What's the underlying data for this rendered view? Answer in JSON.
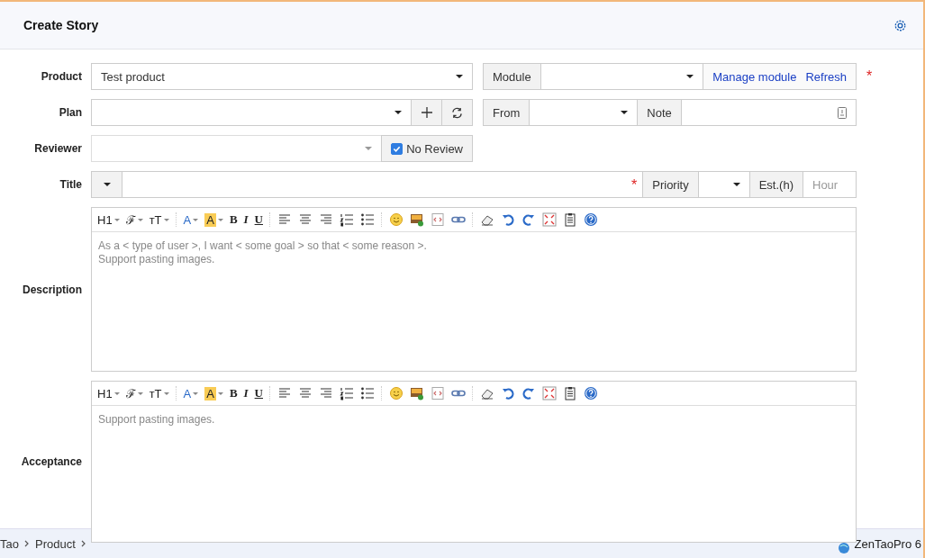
{
  "header": {
    "title": "Create Story"
  },
  "product": {
    "label": "Product",
    "value": "Test product",
    "required_mark": "*",
    "module_label": "Module",
    "links": [
      "Manage module",
      "Refresh"
    ]
  },
  "plan": {
    "label": "Plan",
    "from_label": "From",
    "note_label": "Note"
  },
  "reviewer": {
    "label": "Reviewer",
    "no_review": {
      "label": "No Review",
      "checked": true
    }
  },
  "title": {
    "label": "Title",
    "required_mark": "*",
    "priority_label": "Priority",
    "est_label": "Est.(h)",
    "est_placeholder": "Hour"
  },
  "editors": [
    {
      "label": "Description",
      "lines": [
        "As a < type of user >, I want < some goal > so that < some reason >.",
        "Support pasting images."
      ],
      "toolbar": [
        {
          "kind": "text",
          "label": "H1",
          "dropdown": true
        },
        {
          "kind": "text",
          "label": "ℱ",
          "dropdown": true
        },
        {
          "kind": "text",
          "label": "ᴛT",
          "dropdown": true
        },
        {
          "kind": "separator"
        },
        {
          "kind": "fontcolor",
          "label": "A",
          "dropdown": true
        },
        {
          "kind": "highlight",
          "label": "A",
          "dropdown": true
        },
        {
          "kind": "bold",
          "label": "B",
          "dropdown": false
        },
        {
          "kind": "italic",
          "label": "I",
          "dropdown": false
        },
        {
          "kind": "underline",
          "label": "U",
          "dropdown": false
        },
        {
          "kind": "separator"
        },
        {
          "kind": "align-left"
        },
        {
          "kind": "align-center"
        },
        {
          "kind": "align-right"
        },
        {
          "kind": "ordered-list"
        },
        {
          "kind": "bullet-list"
        },
        {
          "kind": "separator"
        },
        {
          "kind": "emoji"
        },
        {
          "kind": "image"
        },
        {
          "kind": "code"
        },
        {
          "kind": "link"
        },
        {
          "kind": "separator"
        },
        {
          "kind": "eraser"
        },
        {
          "kind": "undo"
        },
        {
          "kind": "redo"
        },
        {
          "kind": "fullscreen"
        },
        {
          "kind": "paste"
        },
        {
          "kind": "help"
        }
      ]
    },
    {
      "label": "Acceptance",
      "lines": [
        "Support pasting images."
      ],
      "toolbar": [
        {
          "kind": "text",
          "label": "H1",
          "dropdown": true
        },
        {
          "kind": "text",
          "label": "ℱ",
          "dropdown": true
        },
        {
          "kind": "text",
          "label": "ᴛT",
          "dropdown": true
        },
        {
          "kind": "separator"
        },
        {
          "kind": "fontcolor",
          "label": "A",
          "dropdown": true
        },
        {
          "kind": "highlight",
          "label": "A",
          "dropdown": true
        },
        {
          "kind": "bold",
          "label": "B",
          "dropdown": false
        },
        {
          "kind": "italic",
          "label": "I",
          "dropdown": false
        },
        {
          "kind": "underline",
          "label": "U",
          "dropdown": false
        },
        {
          "kind": "separator"
        },
        {
          "kind": "align-left"
        },
        {
          "kind": "align-center"
        },
        {
          "kind": "align-right"
        },
        {
          "kind": "ordered-list"
        },
        {
          "kind": "bullet-list"
        },
        {
          "kind": "separator"
        },
        {
          "kind": "emoji"
        },
        {
          "kind": "image"
        },
        {
          "kind": "code"
        },
        {
          "kind": "link"
        },
        {
          "kind": "separator"
        },
        {
          "kind": "eraser"
        },
        {
          "kind": "undo"
        },
        {
          "kind": "redo"
        },
        {
          "kind": "fullscreen"
        },
        {
          "kind": "paste"
        },
        {
          "kind": "help"
        }
      ]
    }
  ],
  "breadcrumb": {
    "items": [
      "Tao",
      "Product"
    ],
    "version": "ZenTaoPro 6"
  }
}
